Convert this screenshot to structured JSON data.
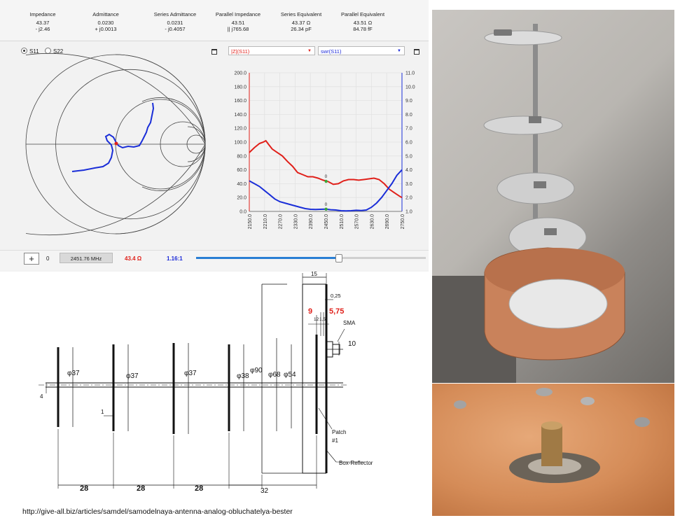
{
  "header": {
    "columns": [
      {
        "title": "Impedance",
        "v1": "43.37",
        "v2": "- j2.46"
      },
      {
        "title": "Admittance",
        "v1": "0.0230",
        "v2": "+ j0.0013"
      },
      {
        "title": "Series Admittance",
        "v1": "0.0231",
        "v2": "- j0.4057"
      },
      {
        "title": "Parallel Impedance",
        "v1": "43.51",
        "v2": "|| j765.68"
      },
      {
        "title": "Series Equivalent",
        "v1": "43.37 Ω",
        "v2": "26.34 pF"
      },
      {
        "title": "Parallel Equivalent",
        "v1": "43.51 Ω",
        "v2": "84.78 fF"
      }
    ]
  },
  "smith": {
    "radio_s11": "S11",
    "radio_s22": "S22",
    "trace_color": "#1a2ed8"
  },
  "chart_controls": {
    "left_select": "|Z|(S11)",
    "right_select": "swr(S11)"
  },
  "marker_label": "0",
  "bottom_bar": {
    "add_label": "+",
    "marker_index": "0",
    "frequency": "2451.76 MHz",
    "impedance": "43.4 Ω",
    "swr": "1.16:1",
    "slider_position": 0.62
  },
  "chart_data": {
    "type": "line",
    "x_ticks": [
      "2150.0",
      "2210.0",
      "2270.0",
      "2330.0",
      "2390.0",
      "2450.0",
      "2510.0",
      "2570.0",
      "2630.0",
      "2690.0",
      "2750.0"
    ],
    "xlim": [
      2150,
      2750
    ],
    "ylim_left": [
      0,
      200
    ],
    "ylim_right": [
      1,
      11
    ],
    "y_ticks_left": [
      "0.0",
      "20.0",
      "40.0",
      "60.0",
      "80.0",
      "100.0",
      "120.0",
      "140.0",
      "160.0",
      "180.0",
      "200.0"
    ],
    "y_ticks_right": [
      "1.0",
      "2.0",
      "3.0",
      "4.0",
      "5.0",
      "6.0",
      "7.0",
      "8.0",
      "9.0",
      "10.0",
      "11.0"
    ],
    "series": [
      {
        "color": "#e0201a",
        "axis": "left",
        "x": [
          2150,
          2170,
          2190,
          2205,
          2215,
          2225,
          2240,
          2260,
          2280,
          2300,
          2320,
          2340,
          2360,
          2380,
          2400,
          2420,
          2440,
          2460,
          2480,
          2500,
          2520,
          2540,
          2560,
          2580,
          2600,
          2620,
          2640,
          2660,
          2680,
          2700,
          2720,
          2740,
          2750
        ],
        "y": [
          85,
          92,
          98,
          100,
          102,
          97,
          90,
          85,
          80,
          72,
          65,
          56,
          53,
          50,
          50,
          48,
          45,
          43,
          39,
          40,
          44,
          46,
          46,
          45,
          46,
          47,
          48,
          46,
          40,
          32,
          27,
          22,
          20
        ]
      },
      {
        "color": "#1a2ed8",
        "axis": "right",
        "x": [
          2150,
          2170,
          2190,
          2210,
          2230,
          2250,
          2270,
          2290,
          2310,
          2330,
          2350,
          2370,
          2390,
          2410,
          2430,
          2450,
          2470,
          2490,
          2510,
          2530,
          2550,
          2570,
          2590,
          2610,
          2630,
          2650,
          2670,
          2690,
          2710,
          2730,
          2750
        ],
        "y": [
          3.2,
          3.0,
          2.8,
          2.5,
          2.2,
          1.9,
          1.7,
          1.6,
          1.5,
          1.4,
          1.3,
          1.2,
          1.15,
          1.14,
          1.15,
          1.16,
          1.12,
          1.1,
          1.05,
          1.04,
          1.05,
          1.08,
          1.06,
          1.1,
          1.3,
          1.6,
          2.0,
          2.5,
          3.0,
          3.6,
          4.0
        ]
      }
    ]
  },
  "drawing": {
    "diameters": [
      "37",
      "37",
      "37",
      "38",
      "90",
      "68",
      "54"
    ],
    "dims_top": [
      "15",
      "0,25",
      "9",
      "5,75",
      "10",
      "4",
      "1"
    ],
    "spacings": [
      "28",
      "28",
      "28",
      "32"
    ],
    "labels": {
      "sma": "SMA",
      "patch": "Patch",
      "patch_num": "#1",
      "reflector": "Box-Reflector"
    },
    "small_dims": [
      "12",
      "1,5"
    ]
  },
  "footer": {
    "url": "http://give-all.biz/articles/samdel/samodelnaya-antenna-analog-obluchatelya-bester"
  }
}
